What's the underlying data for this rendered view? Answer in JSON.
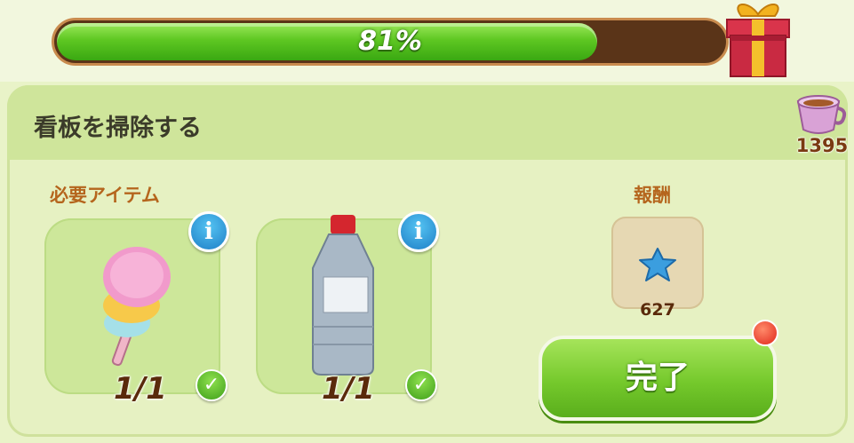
{
  "progress": {
    "percent_label": "81%",
    "value": 0.81
  },
  "task": {
    "title": "看板を掃除する"
  },
  "currency": {
    "cups": "1395"
  },
  "required_items": {
    "label": "必要アイテム",
    "items": [
      {
        "name": "feather-duster",
        "count": "1/1",
        "info": "i",
        "check": "✓"
      },
      {
        "name": "liquid-bottle",
        "count": "1/1",
        "info": "i",
        "check": "✓"
      }
    ]
  },
  "reward": {
    "label": "報酬",
    "value": "627",
    "icon": "blue-star-icon"
  },
  "complete_button": {
    "label": "完了"
  },
  "colors": {
    "accent_green": "#5ec722",
    "progress_track": "#5a3418",
    "label_orange": "#b5651d"
  }
}
